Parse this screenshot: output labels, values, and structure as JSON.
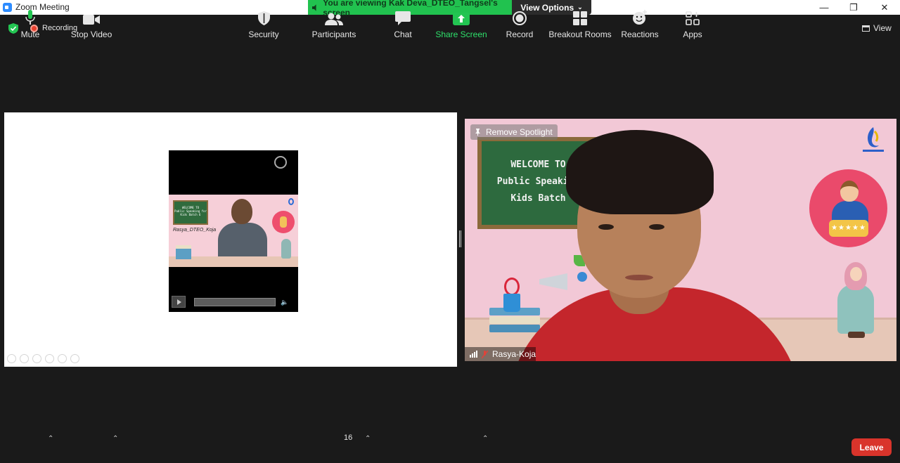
{
  "window": {
    "title": "Zoom Meeting",
    "minimize_icon": "minimize-icon",
    "maximize_icon": "restore-icon",
    "close_icon": "close-icon"
  },
  "share_banner": {
    "text": "You are viewing Kak Deva_DTEO_Tangsel's screen",
    "options_label": "View Options",
    "color": "#21c24f"
  },
  "status": {
    "recording_label": "Recording",
    "view_label": "View"
  },
  "shared_screen": {
    "thumbnail_caption": "Rasya_DTEO_Koja",
    "thumbnail_board_text": "WELCOME TO\nPublic Speaking for\nKids Batch 6"
  },
  "participant_video": {
    "spotlight_label": "Remove Spotlight",
    "board_text": "WELCOME TO\nPublic Speaking\nKids Batch",
    "rating_stars": "★★★★★",
    "participant_name": "Rasya-Koja"
  },
  "toolbar": {
    "mute": "Mute",
    "stop_video": "Stop Video",
    "security": "Security",
    "participants": "Participants",
    "participants_count": "16",
    "chat": "Chat",
    "share_screen": "Share Screen",
    "record": "Record",
    "breakout_rooms": "Breakout Rooms",
    "reactions": "Reactions",
    "apps": "Apps",
    "leave": "Leave",
    "share_color": "#2ee06b",
    "leave_color": "#d9342b"
  }
}
